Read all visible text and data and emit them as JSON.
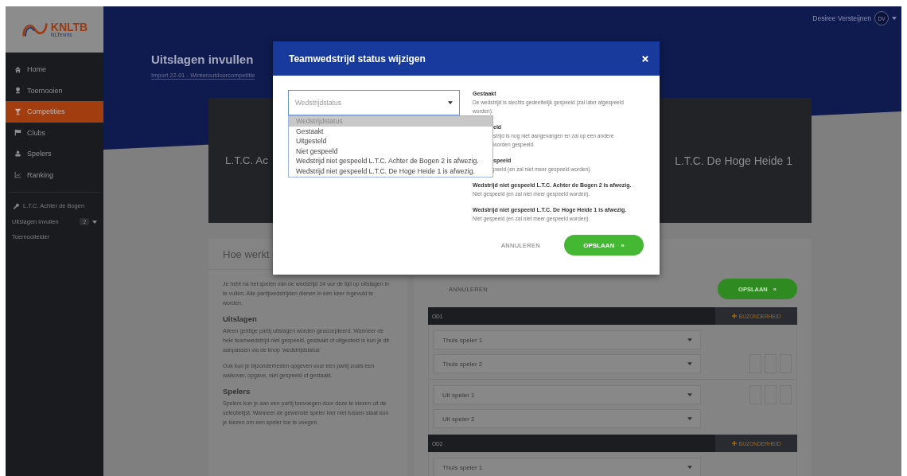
{
  "sidebar": {
    "logo": {
      "name": "KNLTB",
      "tagline": "NLTennis"
    },
    "nav": [
      {
        "label": "Home",
        "selected": false
      },
      {
        "label": "Toernooien",
        "selected": false
      },
      {
        "label": "Competities",
        "selected": true
      },
      {
        "label": "Clubs",
        "selected": false
      },
      {
        "label": "Spelers",
        "selected": false
      },
      {
        "label": "Ranking",
        "selected": false
      }
    ],
    "club": {
      "label": "L.T.C. Achter de Bogen"
    },
    "links": [
      {
        "label": "Uitslagen invullen",
        "badge": "2"
      },
      {
        "label": "Toernooileider"
      }
    ]
  },
  "user": {
    "name": "Desiree Versteijnen",
    "initials": "DV"
  },
  "page": {
    "title": "Uitslagen invullen",
    "subtitle": "Import 22-01 - Winteroutdoorcompetitie"
  },
  "match": {
    "home": "L.T.C. Ac",
    "away": "L.T.C. De Hoge Heide 1"
  },
  "info_card": {
    "title": "Hoe werkt",
    "blocks": [
      {
        "kind": "paragraph",
        "text": "Je hebt na het spelen van de wedstrijd 24 uur de tijd op uitslagen in te vullen. Alle partijwedstrijden dienen in één keer ingevuld te worden."
      },
      {
        "kind": "heading",
        "text": "Uitslagen"
      },
      {
        "kind": "paragraph",
        "text": "Alleen geldige partij uitslagen worden geaccepteerd. Wanneer de hele teamwedstrijd niet gespeeld, gestaakt of uitgesteld is kun je dit aanpassen via de knop 'wedstrijdstatus'"
      },
      {
        "kind": "paragraph",
        "text": "Ook kun je bijzonderheden opgeven voor een partij zoals een walkover, opgave, niet gespeeld of gestaakt."
      },
      {
        "kind": "heading",
        "text": "Spelers"
      },
      {
        "kind": "paragraph",
        "text": "Spelers kun je aan een partij toevoegen door deze te kiezen uit de selectielijst. Wanneer de gewenste speler hier niet tussen staat kun je kiezen om een speler toe te voegen."
      }
    ]
  },
  "results_form": {
    "cancel": "ANNULEREN",
    "save": "OPSLAAN",
    "save_mark": "»",
    "matches": [
      {
        "label": "OD1",
        "detail_button": "BIJZONDERHEID",
        "home_players": [
          "Thuis speler 1",
          "Thuis speler 2"
        ],
        "away_players": [
          "Uit speler 1",
          "Uit speler 2"
        ]
      },
      {
        "label": "OD2",
        "detail_button": "BIJZONDERHEID",
        "home_players": [
          "Thuis speler 1"
        ]
      }
    ]
  },
  "modal": {
    "title": "Teamwedstrijd status wijzigen",
    "select": {
      "placeholder": "Wedstrijdstatus",
      "expanded": true,
      "options": [
        {
          "label": "Wedstrijdstatus",
          "selected": true
        },
        {
          "label": "Gestaakt",
          "selected": false
        },
        {
          "label": "Uitgesteld",
          "selected": false
        },
        {
          "label": "Niet gespeeld",
          "selected": false
        },
        {
          "label": "Wedstrijd niet gespeeld L.T.C. Achter de Bogen 2 is afwezig.",
          "selected": false
        },
        {
          "label": "Wedstrijd niet gespeeld L.T.C. De Hoge Heide 1 is afwezig.",
          "selected": false
        }
      ]
    },
    "descriptions": [
      {
        "kind": "full",
        "title": "Gestaakt",
        "lines": [
          "De wedstrijd is slechts gedeeltelijk gespeeld (zal later afgespeeld worden)."
        ]
      },
      {
        "kind": "partial",
        "title": "eld",
        "lines": [
          "strijd is nog niet aangevangen en zal op een andere",
          "worden gespeeld."
        ]
      },
      {
        "kind": "partial",
        "title": "speeld",
        "lines": [
          "peeld (en zal niet meer gespeeld worden)."
        ]
      },
      {
        "kind": "full",
        "title": "Wedstrijd niet gespeeld L.T.C. Achter de Bogen 2 is afwezig.",
        "lines": [
          "Niet gespeeld (en zal niet meer gespeeld worden)."
        ]
      },
      {
        "kind": "full",
        "title": "Wedstrijd niet gespeeld L.T.C. De Hoge Heide 1 is afwezig.",
        "lines": [
          "Niet gespeeld (en zal niet meer gespeeld worden)."
        ]
      }
    ],
    "cancel": "ANNULEREN",
    "save": "OPSLAAN",
    "save_mark": "»"
  }
}
